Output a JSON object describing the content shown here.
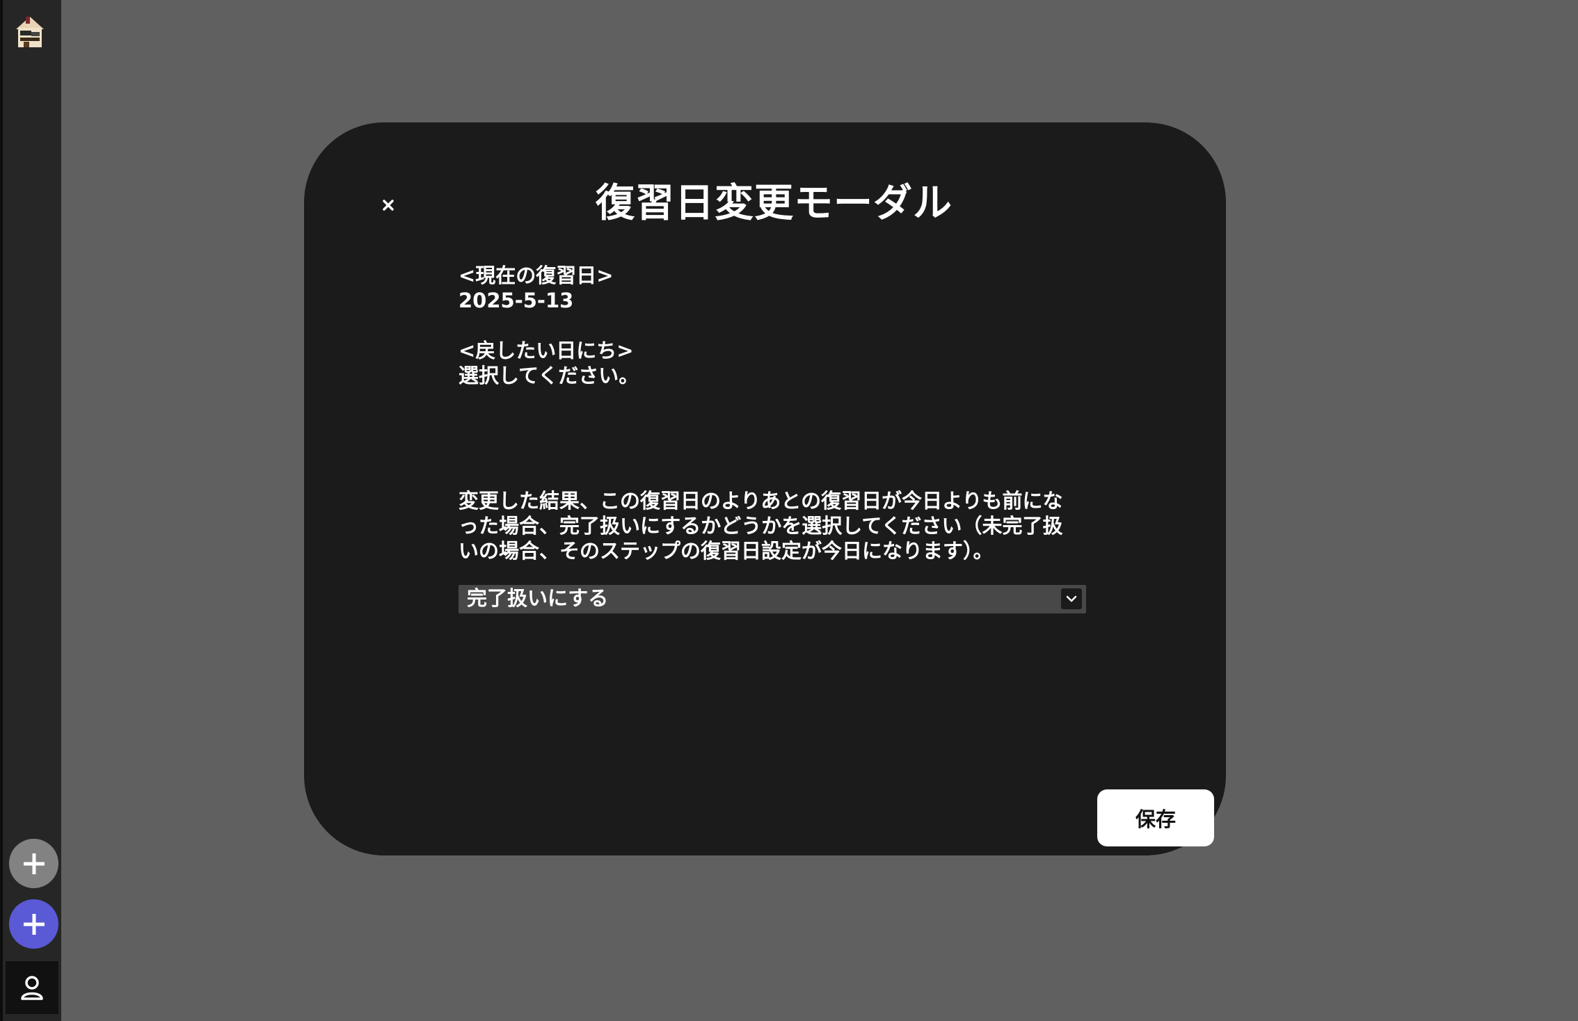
{
  "sidebar": {
    "logo_icon": "house-icon",
    "buttons": [
      {
        "icon": "plus-icon",
        "color": "#828282"
      },
      {
        "icon": "plus-icon",
        "color": "#5a5ad6"
      },
      {
        "icon": "user-icon",
        "color": "#111111"
      }
    ]
  },
  "modal": {
    "close_label": "×",
    "title": "復習日変更モーダル",
    "current_label": "<現在の復習日>",
    "current_date": "2025-5-13",
    "target_label": "<戻したい日にち>",
    "target_prompt": "選択してください。",
    "note": "変更した結果、この復習日のよりあとの復習日が今日よりも前になった場合、完了扱いにするかどうかを選択してください（未完了扱いの場合、そのステップの復習日設定が今日になります）。",
    "select": {
      "value": "完了扱いにする",
      "icon": "chevron-down-icon"
    },
    "save_label": "保存"
  },
  "colors": {
    "background": "#606060",
    "sidebar": "#262626",
    "modal": "#1b1b1b",
    "select": "#484848",
    "accent": "#5a5ad6"
  }
}
